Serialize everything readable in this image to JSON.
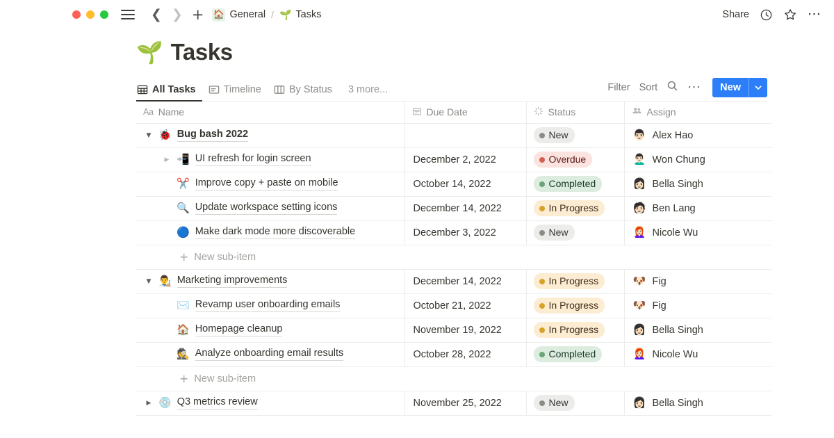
{
  "window": {
    "traffic_lights": [
      "close",
      "minimize",
      "maximize"
    ],
    "menu_icon": "hamburger-icon",
    "back_icon": "chevron-left-icon",
    "forward_icon": "chevron-right-icon",
    "add_icon": "plus-icon"
  },
  "breadcrumb": {
    "home_emoji": "🏠",
    "workspace": "General",
    "separator": "/",
    "page_emoji": "🌱",
    "page": "Tasks"
  },
  "topbar_right": {
    "share_label": "Share",
    "history_icon": "clock-icon",
    "favorite_icon": "star-icon",
    "more_icon": "more-horizontal-icon"
  },
  "page_title": {
    "emoji": "🌱",
    "title": "Tasks"
  },
  "views": {
    "tabs": [
      {
        "label": "All Tasks",
        "icon": "table-icon",
        "active": true
      },
      {
        "label": "Timeline",
        "icon": "timeline-icon",
        "active": false
      },
      {
        "label": "By Status",
        "icon": "board-icon",
        "active": false
      }
    ],
    "more_label": "3 more..."
  },
  "toolbar": {
    "filter_label": "Filter",
    "sort_label": "Sort",
    "search_icon": "search-icon",
    "more_icon": "more-horizontal-icon",
    "new_label": "New",
    "new_caret_icon": "chevron-down-icon",
    "new_color": "#2d7ff9"
  },
  "table": {
    "columns": [
      {
        "label": "Name",
        "icon": "Aa"
      },
      {
        "label": "Due Date",
        "icon": "calendar-icon"
      },
      {
        "label": "Status",
        "icon": "status-spinner-icon"
      },
      {
        "label": "Assign",
        "icon": "people-icon"
      }
    ],
    "new_subitem_label": "New sub-item",
    "status_styles": {
      "New": {
        "bg": "#ececeb",
        "fg": "#37352f",
        "dot": "#8d8b87"
      },
      "Overdue": {
        "bg": "#fbe4e0",
        "fg": "#5d1715",
        "dot": "#d4604f"
      },
      "Completed": {
        "bg": "#dcecdf",
        "fg": "#1c3829",
        "dot": "#6ba577"
      },
      "In Progress": {
        "bg": "#fbecd2",
        "fg": "#402c1b",
        "dot": "#d9a12a"
      }
    },
    "rows": [
      {
        "level": 0,
        "toggle": "open",
        "emoji": "🐞",
        "name": "Bug bash 2022",
        "bold": true,
        "due_date": "",
        "status": "New",
        "assignee": "Alex Hao",
        "avatar": "👨🏻"
      },
      {
        "level": 1,
        "toggle": "closed",
        "emoji": "📲",
        "name": "UI refresh for login screen",
        "bold": false,
        "due_date": "December 2, 2022",
        "status": "Overdue",
        "assignee": "Won Chung",
        "avatar": "👨🏻‍🦱"
      },
      {
        "level": 1,
        "toggle": "none",
        "emoji": "✂️",
        "name": "Improve copy + paste on mobile",
        "bold": false,
        "due_date": "October 14, 2022",
        "status": "Completed",
        "assignee": "Bella Singh",
        "avatar": "👩🏻"
      },
      {
        "level": 1,
        "toggle": "none",
        "emoji": "🔍",
        "name": "Update workspace setting icons",
        "bold": false,
        "due_date": "December 14, 2022",
        "status": "In Progress",
        "assignee": "Ben Lang",
        "avatar": "🧑🏻"
      },
      {
        "level": 1,
        "toggle": "none",
        "emoji": "🔵",
        "name": "Make dark mode more discoverable",
        "bold": false,
        "due_date": "December 3, 2022",
        "status": "New",
        "assignee": "Nicole Wu",
        "avatar": "👩🏻‍🦰"
      },
      {
        "type": "new_subitem"
      },
      {
        "level": 0,
        "toggle": "open",
        "emoji": "👨‍🎨",
        "name": "Marketing improvements",
        "bold": false,
        "due_date": "December 14, 2022",
        "status": "In Progress",
        "assignee": "Fig",
        "avatar": "🐶"
      },
      {
        "level": 1,
        "toggle": "none",
        "emoji": "✉️",
        "name": "Revamp user onboarding emails",
        "bold": false,
        "due_date": "October 21, 2022",
        "status": "In Progress",
        "assignee": "Fig",
        "avatar": "🐶"
      },
      {
        "level": 1,
        "toggle": "none",
        "emoji": "🏠",
        "name": "Homepage cleanup",
        "bold": false,
        "due_date": "November 19, 2022",
        "status": "In Progress",
        "assignee": "Bella Singh",
        "avatar": "👩🏻"
      },
      {
        "level": 1,
        "toggle": "none",
        "emoji": "🕵️",
        "name": "Analyze onboarding email results",
        "bold": false,
        "due_date": "October 28, 2022",
        "status": "Completed",
        "assignee": "Nicole Wu",
        "avatar": "👩🏻‍🦰"
      },
      {
        "type": "new_subitem"
      },
      {
        "level": 0,
        "toggle": "closed",
        "emoji": "💿",
        "name": "Q3 metrics review",
        "bold": false,
        "due_date": "November 25, 2022",
        "status": "New",
        "assignee": "Bella Singh",
        "avatar": "👩🏻"
      }
    ]
  }
}
